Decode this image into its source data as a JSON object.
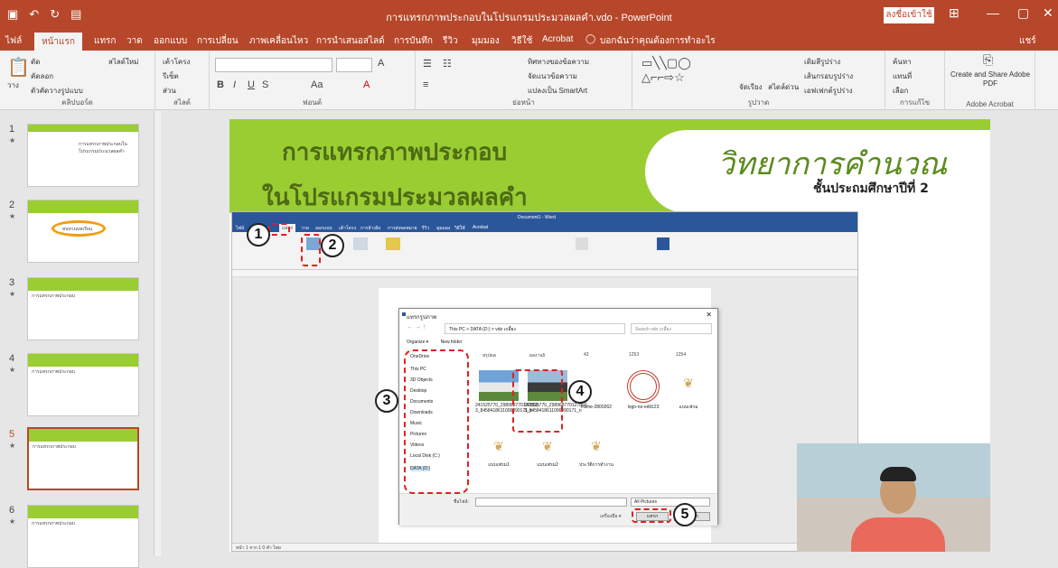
{
  "window": {
    "title": "การแทรกภาพประกอบในโปรแกรมประมวลผลคำ.vdo - PowerPoint",
    "signin_label": "ลงชื่อเข้าใช้",
    "user_label": "แชร์"
  },
  "tabs": [
    "ไฟล์",
    "หน้าแรก",
    "แทรก",
    "วาด",
    "ออกแบบ",
    "การเปลี่ยน",
    "ภาพเคลื่อนไหว",
    "การนำเสนอสไลด์",
    "การบันทึก",
    "รีวิว",
    "มุมมอง",
    "วิธีใช้",
    "Acrobat",
    "บอกฉันว่าคุณต้องการทำอะไร"
  ],
  "ribbon": {
    "clipboard": {
      "paste": "วาง",
      "cut": "ตัด",
      "copy": "คัดลอก",
      "format_painter": "ตัวคัดวางรูปแบบ",
      "label": "คลิปบอร์ด"
    },
    "slides": {
      "new_slide": "สไลด์ใหม่",
      "layout": "เค้าโครง",
      "reset": "รีเซ็ต",
      "section": "ส่วน",
      "label": "สไลด์"
    },
    "font": {
      "label": "ฟอนต์"
    },
    "paragraph": {
      "text_direction": "ทิศทางของข้อความ",
      "align_text": "จัดแนวข้อความ",
      "smartart": "แปลงเป็น SmartArt",
      "label": "ย่อหน้า"
    },
    "drawing": {
      "arrange": "จัดเรียง",
      "quick_styles": "สไตล์ด่วน",
      "shape_fill": "เติมสีรูปร่าง",
      "shape_outline": "เส้นกรอบรูปร่าง",
      "shape_effects": "เอฟเฟกต์รูปร่าง",
      "label": "รูปวาด"
    },
    "editing": {
      "find": "ค้นหา",
      "replace": "แทนที่",
      "select": "เลือก",
      "label": "การแก้ไข"
    },
    "acrobat": {
      "create_share": "Create and Share Adobe PDF",
      "label": "Adobe Acrobat"
    }
  },
  "thumbnails": [
    {
      "num": "1",
      "title": "การแทรกภาพประกอบในโปรแกรมประมวลผลคำ"
    },
    {
      "num": "2",
      "title": "ทบทวนบทเรียน"
    },
    {
      "num": "3",
      "title": "การแทรกภาพประกอบ"
    },
    {
      "num": "4",
      "title": "การแทรกภาพประกอบ"
    },
    {
      "num": "5",
      "title": "การแทรกภาพประกอบ"
    },
    {
      "num": "6",
      "title": "การแทรกภาพประกอบ"
    }
  ],
  "slide": {
    "title_line1": "การแทรกภาพประกอบ",
    "title_line2": "ในโปรแกรมประมวลผลคำ",
    "subject": "วิทยาการคำนวณ",
    "grade": "ชั้นประถมศึกษาปีที่ 2"
  },
  "word": {
    "title": "Document1 - Word",
    "tabs": [
      "ไฟล์",
      "หน้าแรก",
      "แทรก",
      "วาด",
      "ออกแบบ",
      "เค้าโครง",
      "การอ้างอิง",
      "การส่งจดหมาย",
      "รีวิว",
      "มุมมอง",
      "วิธีใช้",
      "Acrobat"
    ],
    "status": "หน้า 1 จาก 1   0 คำ   ไทย"
  },
  "dialog": {
    "title": "แทรกรูปภาพ",
    "address": "This PC  >  DATA (D:)  >  vdo เกลี้ยง",
    "search_placeholder": "Search vdo เกลี้ยง",
    "organize": "Organize ▾",
    "new_folder": "New folder",
    "nav": [
      "OneDrive",
      "This PC",
      "3D Objects",
      "Desktop",
      "Documents",
      "Downloads",
      "Music",
      "Pictures",
      "Videos",
      "Local Disk (C:)",
      "DATA (D:)"
    ],
    "files": [
      {
        "name": "241525770_298968770127850 3_8458418611006090171_n"
      },
      {
        "name": "241525770_298968770127850 3_8458418611006090171_n"
      },
      {
        "name": "frame-2800262"
      },
      {
        "name": "logo-no-edit123"
      },
      {
        "name": "แบบเฟรม"
      },
      {
        "name": "แบบเฟรม1"
      },
      {
        "name": "แบบเฟรม2"
      },
      {
        "name": "ประวัติการทำงาน"
      }
    ],
    "top_labels": [
      "สรุปผล",
      "ผลงาน5",
      "43",
      "1253",
      "1254"
    ],
    "filename_label": "ชื่อไฟล์:",
    "filetype": "All Pictures",
    "tools_label": "เครื่องมือ ▾",
    "insert_label": "แทรก",
    "cancel_label": "ยกเลิก"
  },
  "steps": [
    "1",
    "2",
    "3",
    "4",
    "5"
  ],
  "colors": {
    "accent": "#b7472a",
    "slide_green": "#9acd32",
    "step_red": "#e02020"
  }
}
